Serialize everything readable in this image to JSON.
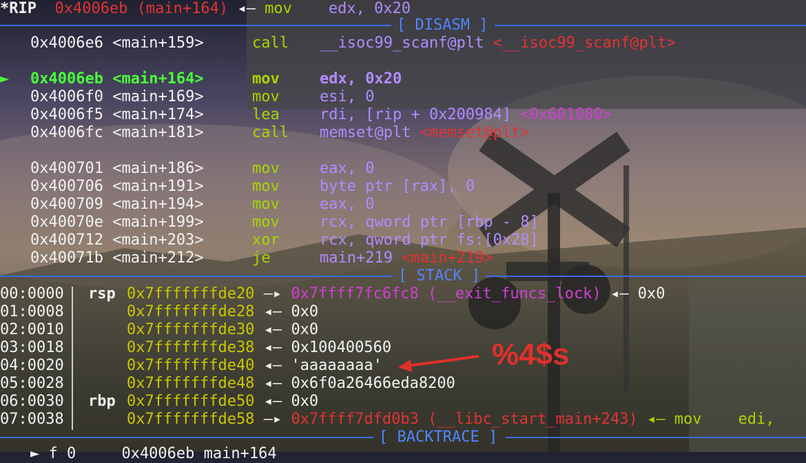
{
  "header": {
    "prefix": "*RIP",
    "addr": "0x4006eb (main+164)",
    "arrow": "◂—",
    "instr": "mov",
    "operands": "edx, 0x20"
  },
  "disasm_title": "[ DISASM ]",
  "stack_title": "[ STACK ]",
  "backtrace_title": "[ BACKTRACE ]",
  "disasm": [
    {
      "addr": "0x4006e6",
      "sym": "<main+159>",
      "op": "call",
      "args": "__isoc99_scanf@plt",
      "comment": "<__isoc99_scanf@plt>"
    },
    {
      "marker": "►",
      "addr": "0x4006eb",
      "sym": "<main+164>",
      "op": "mov",
      "args": "edx, 0x20"
    },
    {
      "addr": "0x4006f0",
      "sym": "<main+169>",
      "op": "mov",
      "args": "esi, 0"
    },
    {
      "addr": "0x4006f5",
      "sym": "<main+174>",
      "op": "lea",
      "args": "rdi, [rip + 0x200984]",
      "comment": "<0x601080>"
    },
    {
      "addr": "0x4006fc",
      "sym": "<main+181>",
      "op": "call",
      "args": "memset@plt",
      "comment": "<memset@plt>"
    },
    {
      "addr": "0x400701",
      "sym": "<main+186>",
      "op": "mov",
      "args": "eax, 0"
    },
    {
      "addr": "0x400706",
      "sym": "<main+191>",
      "op": "mov",
      "args": "byte ptr [rax], 0"
    },
    {
      "addr": "0x400709",
      "sym": "<main+194>",
      "op": "mov",
      "args": "eax, 0"
    },
    {
      "addr": "0x40070e",
      "sym": "<main+199>",
      "op": "mov",
      "args": "rcx, qword ptr [rbp - 8]"
    },
    {
      "addr": "0x400712",
      "sym": "<main+203>",
      "op": "xor",
      "args": "rcx, qword ptr fs:[0x28]"
    },
    {
      "addr": "0x40071b",
      "sym": "<main+212>",
      "op": "je",
      "args": "main+219",
      "comment": "<main+219>"
    }
  ],
  "stack": [
    {
      "idx": "00:0000",
      "reg": "rsp",
      "addr": "0x7fffffffde20",
      "arrow": "—▸",
      "val": "0x7ffff7fc6fc8 (__exit_funcs_lock)",
      "tail": "◂— 0x0"
    },
    {
      "idx": "01:0008",
      "reg": "",
      "addr": "0x7fffffffde28",
      "arrow": "◂—",
      "val": "0x0"
    },
    {
      "idx": "02:0010",
      "reg": "",
      "addr": "0x7fffffffde30",
      "arrow": "◂—",
      "val": "0x0"
    },
    {
      "idx": "03:0018",
      "reg": "",
      "addr": "0x7fffffffde38",
      "arrow": "◂—",
      "val": "0x100400560"
    },
    {
      "idx": "04:0020",
      "reg": "",
      "addr": "0x7fffffffde40",
      "arrow": "◂—",
      "val": "'aaaaaaaa'"
    },
    {
      "idx": "05:0028",
      "reg": "",
      "addr": "0x7fffffffde48",
      "arrow": "◂—",
      "val": "0x6f0a26466eda8200"
    },
    {
      "idx": "06:0030",
      "reg": "rbp",
      "addr": "0x7fffffffde50",
      "arrow": "◂—",
      "val": "0x0"
    },
    {
      "idx": "07:0038",
      "reg": "",
      "addr": "0x7fffffffde58",
      "arrow": "—▸",
      "val": "0x7ffff7dfd0b3 (__libc_start_main+243)",
      "tail": "◂— mov    edi,"
    }
  ],
  "annotation": "%4$s",
  "backtrace_partial": "► f 0     0x4006eb main+164"
}
